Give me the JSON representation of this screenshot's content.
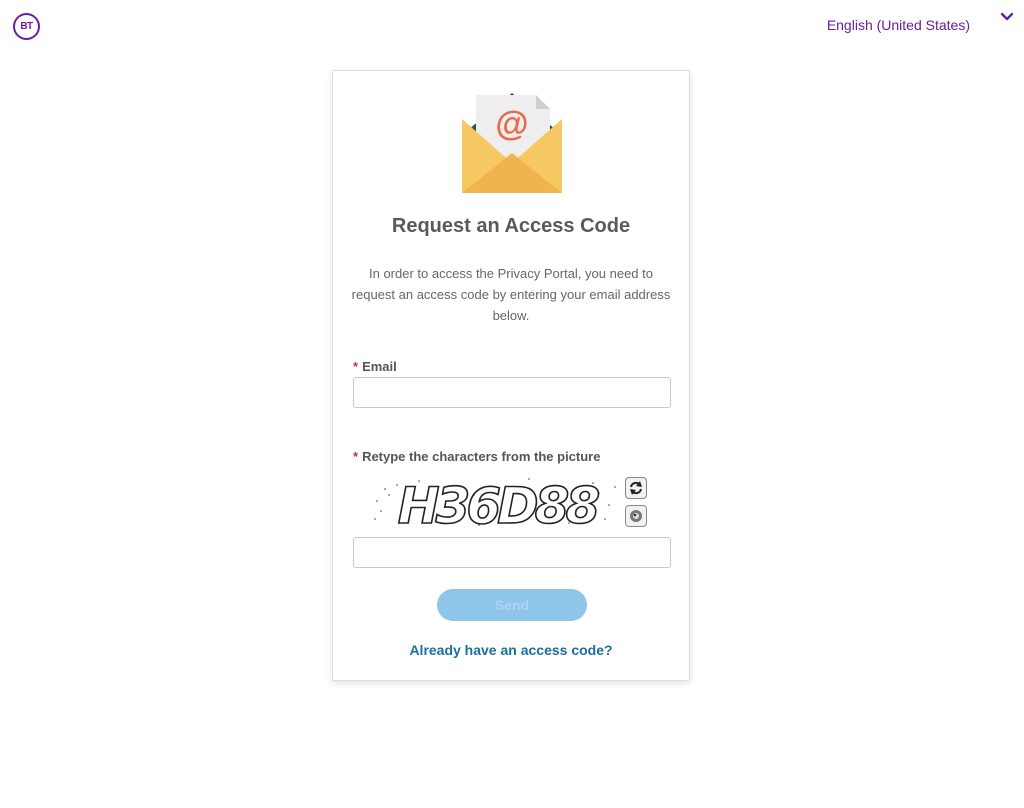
{
  "header": {
    "logo_text": "BT",
    "language": "English (United States)",
    "language_icon": "chevron-down-icon",
    "brand_color": "#6b1d9e"
  },
  "card": {
    "title": "Request an Access Code",
    "description": "In order to access the Privacy Portal, you need to request an access code by entering your email address below.",
    "email": {
      "required_marker": "*",
      "label": "Email",
      "value": "",
      "placeholder": ""
    },
    "captcha": {
      "required_marker": "*",
      "label": "Retype the characters from the picture",
      "image_text": "H36D88",
      "refresh_icon": "refresh-icon",
      "audio_icon": "audio-icon",
      "value": "",
      "placeholder": ""
    },
    "send_label": "Send",
    "send_color": "#8ec6ea",
    "access_code_link": "Already have an access code?",
    "link_color": "#1a6fa0"
  }
}
